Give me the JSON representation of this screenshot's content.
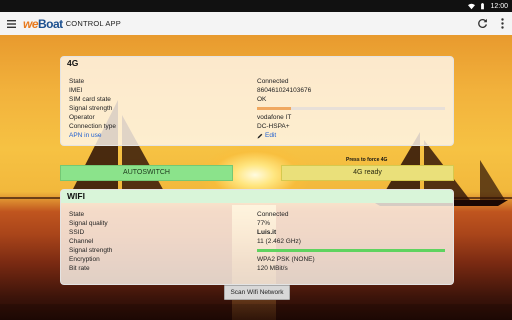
{
  "status_bar": {
    "time": "12:00",
    "icons": [
      "wifi-icon",
      "battery-icon"
    ]
  },
  "app_bar": {
    "logo_prefix": "we",
    "logo_suffix": "Boat",
    "title": "CONTROL APP",
    "actions": [
      "refresh-icon",
      "more-vert-icon"
    ]
  },
  "cellular": {
    "title": "4G",
    "rows": [
      {
        "label": "State",
        "value": "Connected"
      },
      {
        "label": "IMEI",
        "value": "860461024103676"
      },
      {
        "label": "SIM card state",
        "value": "OK"
      },
      {
        "label": "Signal strength",
        "value": "",
        "level": 0.18,
        "bar_color": "#f0a860"
      },
      {
        "label": "Operator",
        "value": "vodafone IT"
      },
      {
        "label": "Connection type",
        "value": "DC-HSPA+"
      },
      {
        "label": "APN in use",
        "value": ""
      }
    ],
    "edit_label": "Edit"
  },
  "controls": {
    "autoswitch_label": "AUTOSWITCH",
    "press_hint": "Press to force 4G",
    "ready_label": "4G ready"
  },
  "wifi": {
    "title": "WIFI",
    "rows": [
      {
        "label": "State",
        "value": "Connected"
      },
      {
        "label": "Signal quality",
        "value": "77%"
      },
      {
        "label": "SSID",
        "value": "Luis.it"
      },
      {
        "label": "Channel",
        "value": "11 (2.462 GHz)"
      },
      {
        "label": "Signal strength",
        "value": "",
        "level": 1.0,
        "bar_color": "#5fd35f"
      },
      {
        "label": "Encryption",
        "value": "WPA2 PSK (NONE)"
      },
      {
        "label": "Bit rate",
        "value": "120 MBit/s"
      }
    ],
    "scan_label": "Scan Wifi Network"
  },
  "colors": {
    "accent_blue": "#1f5fd0",
    "autoswitch_green": "#8be38b",
    "ready_yellow": "#eae07a",
    "wifi_header": "#d9f5d9"
  }
}
